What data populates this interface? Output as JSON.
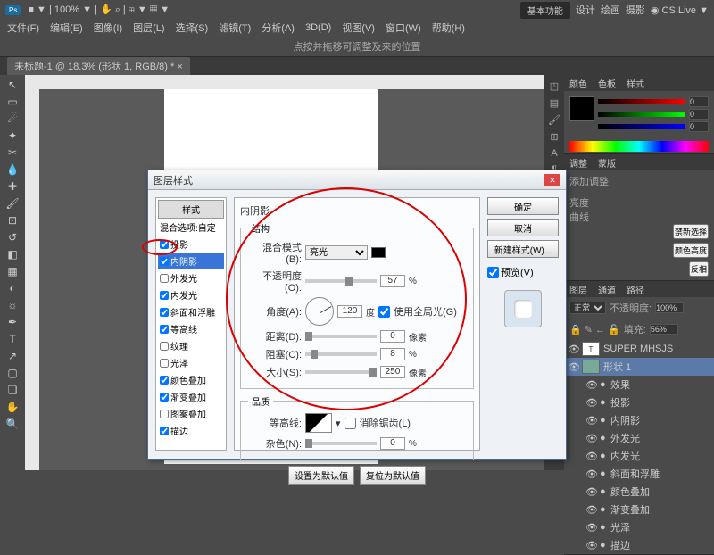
{
  "app": {
    "title": "Ps"
  },
  "topbar": {
    "basic": "基本功能",
    "design": "设计",
    "draw": "绘画",
    "photo": "摄影",
    "cslive": "CS Live"
  },
  "menu": [
    "文件(F)",
    "编辑(E)",
    "图像(I)",
    "图层(L)",
    "选择(S)",
    "滤镜(T)",
    "分析(A)",
    "3D(D)",
    "视图(V)",
    "窗口(W)",
    "帮助(H)"
  ],
  "optbar": {
    "hint": "点按并拖移可调整及来的位置"
  },
  "doctab": {
    "label": "未标题-1 @ 18.3% (形状 1, RGB/8) *"
  },
  "canvas": {
    "text": "SUPER MHSJS"
  },
  "color": {
    "tabs": [
      "颜色",
      "色板",
      "样式"
    ],
    "r": "0",
    "g": "0",
    "b": "0"
  },
  "adjust": {
    "tabs": [
      "调整",
      "蒙版"
    ],
    "hint": "添加调整",
    "brightness": "亮度",
    "curves": "曲线",
    "disable": "禁新选择",
    "color_btn": "颜色高度",
    "invert": "反相"
  },
  "layers": {
    "tabs": [
      "图层",
      "通道",
      "路径"
    ],
    "mode_label": "正常",
    "opacity_label": "不透明度:",
    "opacity": "100%",
    "fill_label": "填充:",
    "fill": "56%",
    "items": [
      {
        "name": "SUPER MHSJS",
        "type": "T"
      },
      {
        "name": "形状 1",
        "type": "shape",
        "sel": true
      },
      {
        "name": "效果",
        "sub": true
      },
      {
        "name": "投影",
        "sub": true
      },
      {
        "name": "内阴影",
        "sub": true
      },
      {
        "name": "外发光",
        "sub": true
      },
      {
        "name": "内发光",
        "sub": true
      },
      {
        "name": "斜面和浮雕",
        "sub": true
      },
      {
        "name": "颜色叠加",
        "sub": true
      },
      {
        "name": "渐变叠加",
        "sub": true
      },
      {
        "name": "光泽",
        "sub": true
      },
      {
        "name": "描边",
        "sub": true
      }
    ]
  },
  "dialog": {
    "title": "图层样式",
    "styles_header": "样式",
    "blend_opts": "混合选项:自定",
    "list": [
      {
        "label": "投影",
        "checked": true
      },
      {
        "label": "内阴影",
        "checked": true,
        "sel": true
      },
      {
        "label": "外发光",
        "checked": false
      },
      {
        "label": "内发光",
        "checked": true
      },
      {
        "label": "斜面和浮雕",
        "checked": true
      },
      {
        "label": "等高线",
        "checked": true
      },
      {
        "label": "纹理",
        "checked": false
      },
      {
        "label": "光泽",
        "checked": false
      },
      {
        "label": "颜色叠加",
        "checked": true
      },
      {
        "label": "渐变叠加",
        "checked": true
      },
      {
        "label": "图案叠加",
        "checked": false
      },
      {
        "label": "描边",
        "checked": true
      }
    ],
    "section_title": "内阴影",
    "structure": "结构",
    "blend_mode_label": "混合模式(B):",
    "blend_mode": "亮光",
    "opacity_label": "不透明度(O):",
    "opacity": "57",
    "opacity_unit": "%",
    "angle_label": "角度(A):",
    "angle": "120",
    "angle_unit": "度",
    "global_light": "使用全局光(G)",
    "distance_label": "距离(D):",
    "distance": "0",
    "distance_unit": "像素",
    "choke_label": "阻塞(C):",
    "choke": "8",
    "choke_unit": "%",
    "size_label": "大小(S):",
    "size": "250",
    "size_unit": "像素",
    "quality": "品质",
    "contour_label": "等高线:",
    "antialiased": "消除锯齿(L)",
    "noise_label": "杂色(N):",
    "noise": "0",
    "noise_unit": "%",
    "make_default": "设置为默认值",
    "reset_default": "复位为默认值",
    "ok": "确定",
    "cancel": "取消",
    "new_style": "新建样式(W)...",
    "preview": "预览(V)"
  }
}
